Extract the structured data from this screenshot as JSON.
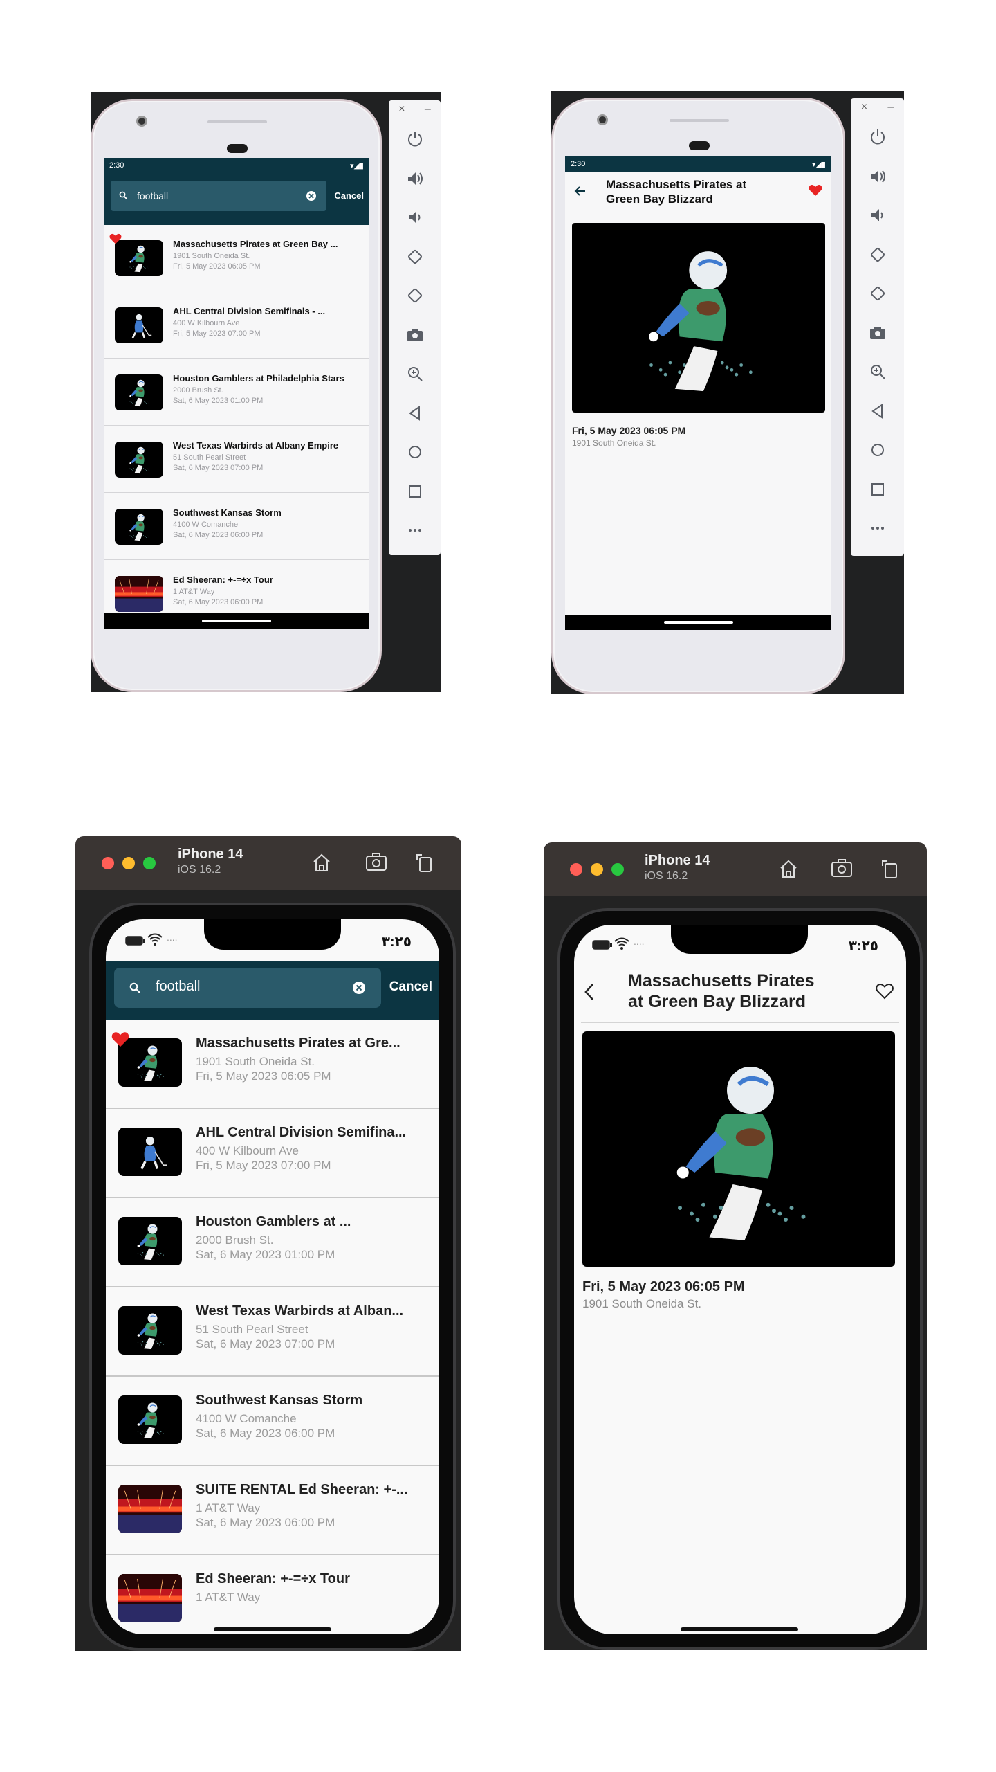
{
  "android_search": {
    "time": "2:30",
    "search_value": "football",
    "cancel_label": "Cancel",
    "results": [
      {
        "title": "Massachusetts Pirates at Green Bay ...",
        "address": "1901 South Oneida St.",
        "date": "Fri, 5 May 2023 06:05 PM",
        "favorite": true,
        "thumb": "football-player"
      },
      {
        "title": "AHL Central Division Semifinals - ...",
        "address": "400 W Kilbourn Ave",
        "date": "Fri, 5 May 2023 07:00 PM",
        "favorite": false,
        "thumb": "hockey-player"
      },
      {
        "title": "Houston Gamblers at Philadelphia Stars",
        "address": "2000 Brush St.",
        "date": "Sat, 6 May 2023 01:00 PM",
        "favorite": false,
        "thumb": "football-player"
      },
      {
        "title": "West Texas Warbirds at Albany Empire",
        "address": "51 South Pearl Street",
        "date": "Sat, 6 May 2023 07:00 PM",
        "favorite": false,
        "thumb": "football-player"
      },
      {
        "title": "Southwest Kansas Storm",
        "address": "4100 W Comanche",
        "date": "Sat, 6 May 2023 06:00 PM",
        "favorite": false,
        "thumb": "football-player"
      },
      {
        "title": "Ed Sheeran: +-=÷x Tour",
        "address": "1 AT&T Way",
        "date": "Sat, 6 May 2023 06:00 PM",
        "favorite": false,
        "thumb": "concert"
      }
    ]
  },
  "android_detail": {
    "time": "2:30",
    "title_line1": "Massachusetts Pirates at",
    "title_line2": "Green Bay Blizzard",
    "date": "Fri, 5 May 2023 06:05 PM",
    "address": "1901 South Oneida St.",
    "favorite": true
  },
  "ios_search": {
    "device": "iPhone 14",
    "os": "iOS 16.2",
    "time": "٣:٢٥",
    "search_value": "football",
    "cancel_label": "Cancel",
    "results": [
      {
        "title": "Massachusetts Pirates at Gre...",
        "address": "1901 South Oneida St.",
        "date": "Fri, 5 May 2023 06:05 PM",
        "favorite": true,
        "thumb": "football-player"
      },
      {
        "title": "AHL Central Division Semifina...",
        "address": "400 W Kilbourn Ave",
        "date": "Fri, 5 May 2023 07:00 PM",
        "favorite": false,
        "thumb": "hockey-player"
      },
      {
        "title": "Houston Gamblers at ...",
        "address": "2000 Brush St.",
        "date": "Sat, 6 May 2023 01:00 PM",
        "favorite": false,
        "thumb": "football-player"
      },
      {
        "title": "West Texas Warbirds at Alban...",
        "address": "51 South Pearl Street",
        "date": "Sat, 6 May 2023 07:00 PM",
        "favorite": false,
        "thumb": "football-player"
      },
      {
        "title": "Southwest Kansas Storm",
        "address": "4100 W Comanche",
        "date": "Sat, 6 May 2023 06:00 PM",
        "favorite": false,
        "thumb": "football-player"
      },
      {
        "title": "SUITE RENTAL Ed Sheeran: +-...",
        "address": "1 AT&T Way",
        "date": "Sat, 6 May 2023 06:00 PM",
        "favorite": false,
        "thumb": "concert"
      },
      {
        "title": "Ed Sheeran: +-=÷x Tour",
        "address": "1 AT&T Way",
        "date": "",
        "favorite": false,
        "thumb": "concert"
      }
    ]
  },
  "ios_detail": {
    "device": "iPhone 14",
    "os": "iOS 16.2",
    "time": "٣:٢٥",
    "title_line1": "Massachusetts Pirates",
    "title_line2": "at Green Bay Blizzard",
    "date": "Fri, 5 May 2023 06:05 PM",
    "address": "1901 South Oneida St.",
    "favorite": false
  },
  "colors": {
    "app_bar": "#0c3542",
    "search_field": "#2a5a6a",
    "favorite": "#e82424",
    "simulator_titlebar": "#3a3533"
  }
}
